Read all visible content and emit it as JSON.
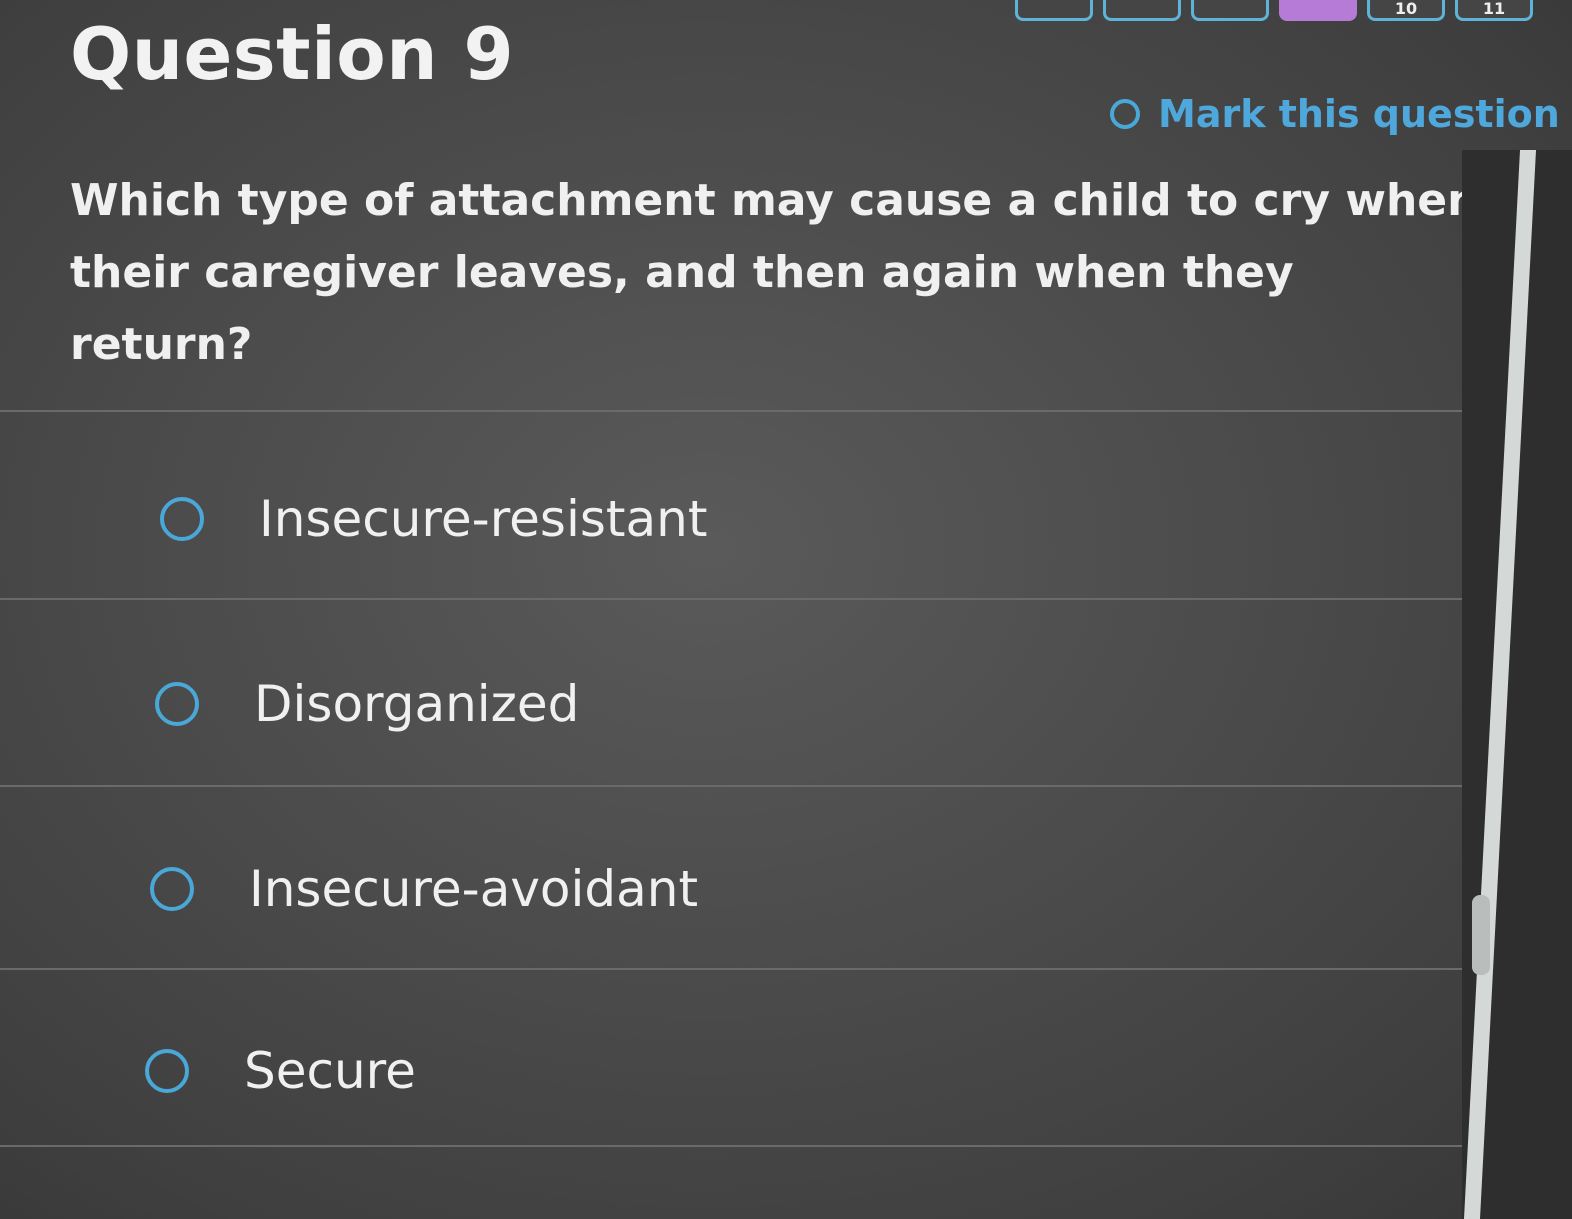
{
  "header": {
    "title": "Question 9",
    "mark_label": "Mark this question"
  },
  "question_nav": {
    "items": [
      {
        "label": "",
        "current": false
      },
      {
        "label": "",
        "current": false
      },
      {
        "label": "",
        "current": false
      },
      {
        "label": "",
        "current": true
      },
      {
        "label": "10",
        "current": false
      },
      {
        "label": "11",
        "current": false
      }
    ]
  },
  "question": {
    "prompt": "Which type of attachment may cause a child to cry when their caregiver leaves, and then again when they return?"
  },
  "options": [
    {
      "label": "Insecure-resistant"
    },
    {
      "label": "Disorganized"
    },
    {
      "label": "Insecure-avoidant"
    },
    {
      "label": "Secure"
    }
  ],
  "colors": {
    "accent": "#4aa8d8",
    "current_question": "#b57bd6",
    "background": "#4a4a4a"
  }
}
